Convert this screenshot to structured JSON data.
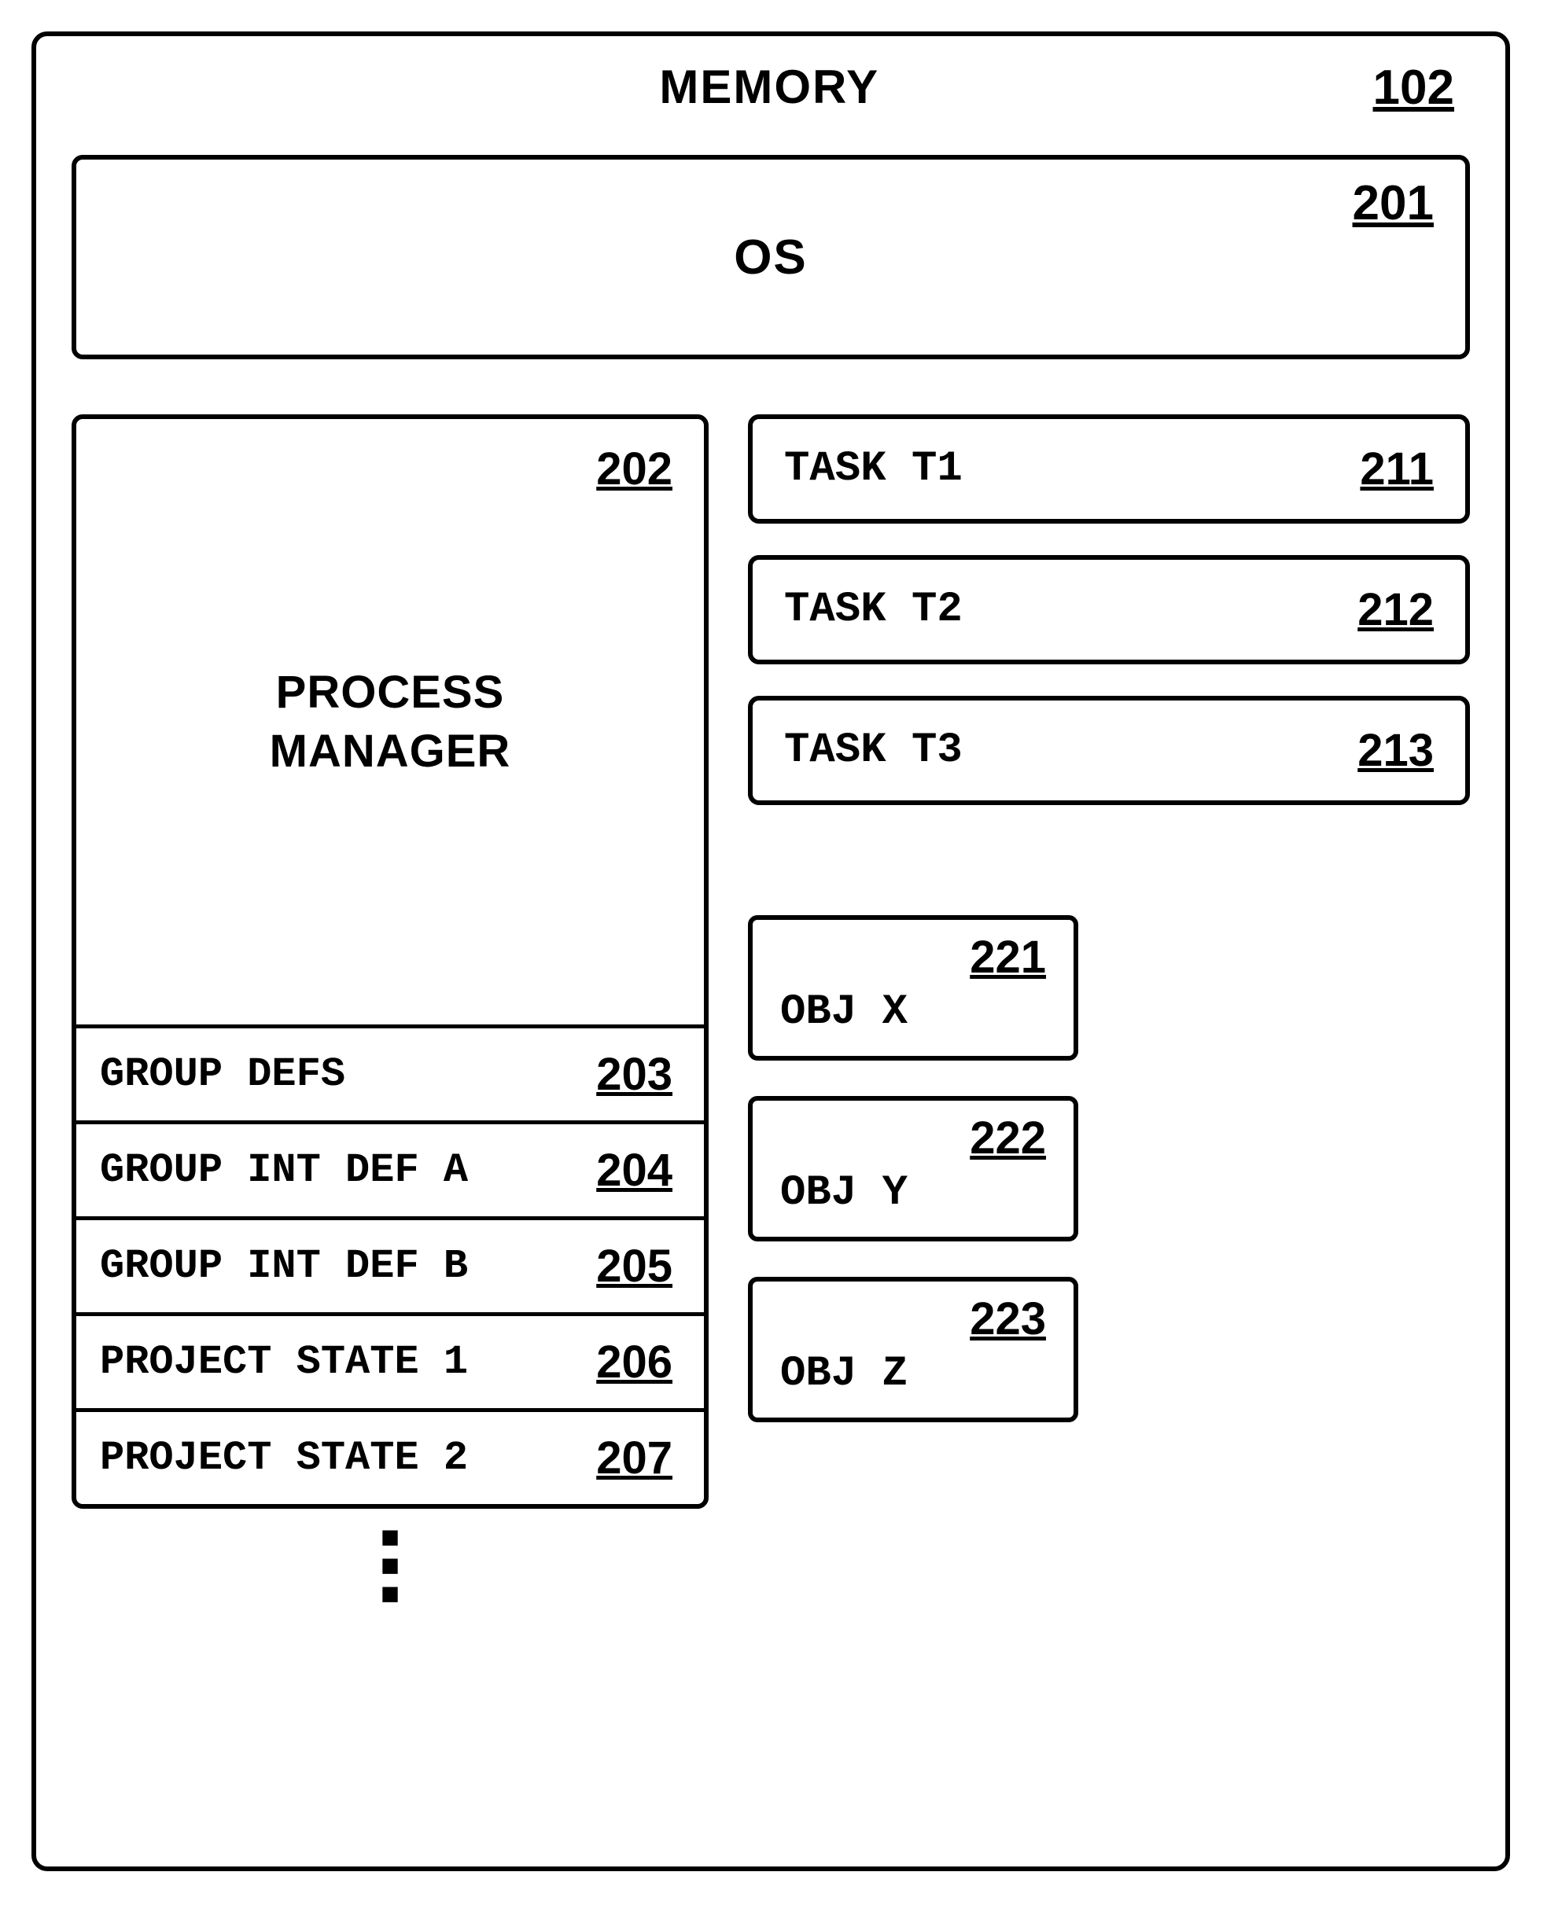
{
  "memory": {
    "title": "MEMORY",
    "ref": "102"
  },
  "os": {
    "label": "OS",
    "ref": "201"
  },
  "process_manager": {
    "ref": "202",
    "label_line1": "PROCESS",
    "label_line2": "MANAGER",
    "rows": [
      {
        "label": "GROUP DEFS",
        "ref": "203"
      },
      {
        "label": "GROUP INT DEF A",
        "ref": "204"
      },
      {
        "label": "GROUP INT DEF B",
        "ref": "205"
      },
      {
        "label": "PROJECT STATE 1",
        "ref": "206"
      },
      {
        "label": "PROJECT STATE 2",
        "ref": "207"
      }
    ]
  },
  "tasks": [
    {
      "label": "TASK T1",
      "ref": "211"
    },
    {
      "label": "TASK T2",
      "ref": "212"
    },
    {
      "label": "TASK T3",
      "ref": "213"
    }
  ],
  "objects": [
    {
      "label": "OBJ X",
      "ref": "221"
    },
    {
      "label": "OBJ Y",
      "ref": "222"
    },
    {
      "label": "OBJ Z",
      "ref": "223"
    }
  ]
}
